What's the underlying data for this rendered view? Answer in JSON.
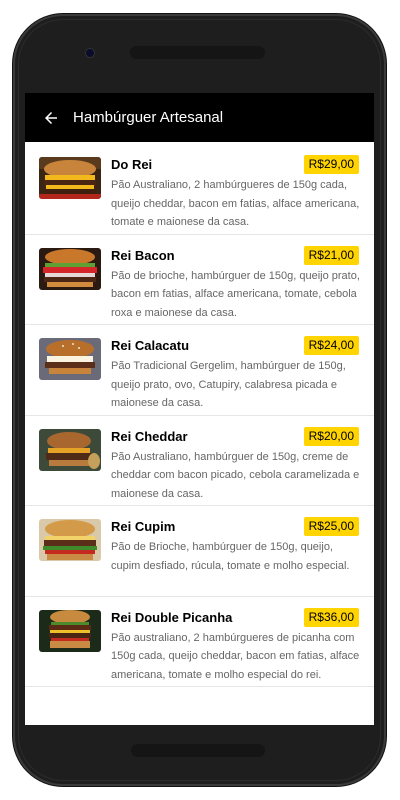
{
  "appbar": {
    "title": "Hambúrguer Artesanal",
    "back_icon": "arrow-left-icon"
  },
  "colors": {
    "appbar_bg": "#000000",
    "price_badge": "#ffd400"
  },
  "items": [
    {
      "name": "Do Rei",
      "price": "R$29,00",
      "description": "Pão Australiano, 2 hambúrgueres de 150g cada, queijo cheddar, bacon em fatias, alface americana, tomate e maionese da casa."
    },
    {
      "name": "Rei Bacon",
      "price": "R$21,00",
      "description": "Pão de brioche, hambúrguer de 150g, queijo prato, bacon em fatias, alface americana, tomate, cebola roxa e maionese da casa."
    },
    {
      "name": "Rei Calacatu",
      "price": "R$24,00",
      "description": "Pão Tradicional Gergelim, hambúrguer de 150g, queijo prato, ovo, Catupiry, calabresa picada e maionese da casa."
    },
    {
      "name": "Rei Cheddar",
      "price": "R$20,00",
      "description": "Pão Australiano, hambúrguer de 150g, creme de cheddar com bacon picado, cebola caramelizada e maionese da casa."
    },
    {
      "name": "Rei Cupim",
      "price": "R$25,00",
      "description": "Pão de Brioche, hambúrguer de 150g, queijo, cupim desfiado, rúcula, tomate e molho especial."
    },
    {
      "name": "Rei Double Picanha",
      "price": "R$36,00",
      "description": "Pão australiano, 2 hambúrgueres de picanha com 150g cada, queijo cheddar, bacon em fatias, alface americana, tomate e molho especial do rei."
    }
  ]
}
